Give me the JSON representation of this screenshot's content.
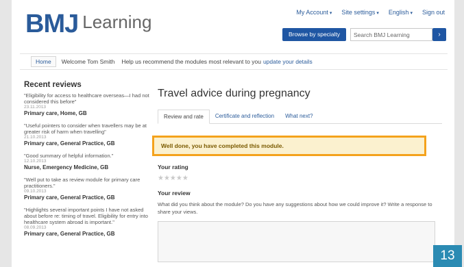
{
  "brand": {
    "bmj": "BMJ",
    "learning": "Learning"
  },
  "topnav": [
    {
      "label": "My Account",
      "caret": "▾"
    },
    {
      "label": "Site settings",
      "caret": "▾"
    },
    {
      "label": "English",
      "caret": "▾"
    },
    {
      "label": "Sign out",
      "caret": ""
    }
  ],
  "search": {
    "specialty_label": "Browse by specialty",
    "value": "Search BMJ Learning",
    "go": "›"
  },
  "welcome_bar": {
    "home": "Home",
    "welcome": "Welcome Tom Smith",
    "help": "Help us recommend the modules most relevant to you",
    "link": "update your details"
  },
  "reviews": {
    "title": "Recent reviews",
    "items": [
      {
        "quote": "\"Eligibility for access to healthcare overseas—I had not considered this before\"",
        "date": "23.11.2013",
        "author": "Primary care, Home, GB"
      },
      {
        "quote": "\"Useful pointers to consider when travellers may be at greater risk of harm when travelling\"",
        "date": "21.10.2013",
        "author": "Primary care, General Practice, GB"
      },
      {
        "quote": "\"Good summary of helpful information.\"",
        "date": "12.10.2013",
        "author": "Nurse, Emergency Medicine, GB"
      },
      {
        "quote": "\"Well put to take as review module for primary care practitioners.\"",
        "date": "09.10.2013",
        "author": "Primary care, General Practice, GB"
      },
      {
        "quote": "\"Highlights several important points I have not asked about before re: timing of travel. Eligibility for entry into healthcare system abroad is important.\"",
        "date": "08.09.2013",
        "author": "Primary care, General Practice, GB"
      }
    ]
  },
  "main": {
    "title": "Travel advice during pregnancy",
    "tabs": [
      {
        "label": "Review and rate",
        "active": true
      },
      {
        "label": "Certificate and reflection",
        "active": false
      },
      {
        "label": "What next?",
        "active": false
      }
    ],
    "completion_message": "Well done, you have completed this module.",
    "rating_label": "Your rating",
    "stars": "★★★★★",
    "star_rating": 0,
    "review_label": "Your review",
    "review_prompt": "What did you think about the module? Do you have any suggestions about how we could improve it? Write a response to share your views.",
    "review_value": ""
  },
  "page_number": "13",
  "colors": {
    "brand_blue": "#2a5b9a",
    "button_blue": "#1f56a3",
    "highlight_border": "#f4a21c",
    "page_badge": "#2b8bb3"
  }
}
